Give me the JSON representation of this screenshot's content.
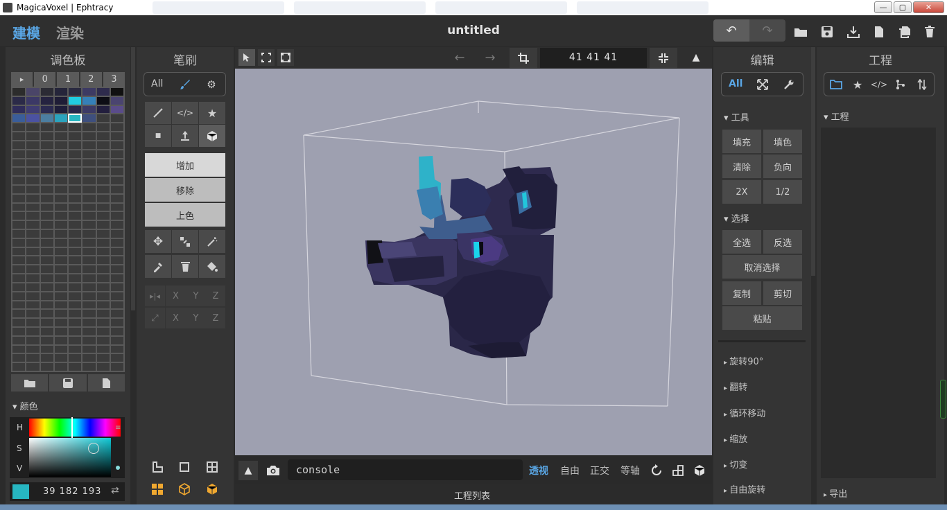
{
  "window": {
    "title": "MagicaVoxel | Ephtracy",
    "min": "—",
    "max": "▢",
    "close": "✕"
  },
  "appbar": {
    "tab_model": "建模",
    "tab_render": "渲染",
    "doc_title": "untitled"
  },
  "palette": {
    "title": "调色板",
    "tabs": [
      "▸",
      "0",
      "1",
      "2",
      "3"
    ],
    "color_section": "颜色",
    "h": "H",
    "s": "S",
    "v": "V",
    "rgb": "39 182 193",
    "selected_color": "#27b6c1"
  },
  "brush": {
    "title": "笔刷",
    "filter_all": "All",
    "mode_add": "增加",
    "mode_remove": "移除",
    "mode_paint": "上色",
    "axis_x": "X",
    "axis_y": "Y",
    "axis_z": "Z"
  },
  "viewbar": {
    "size": "41  41  41"
  },
  "bottombar": {
    "console_placeholder": "console",
    "view_persp": "透视",
    "view_free": "自由",
    "view_ortho": "正交",
    "view_iso": "等轴",
    "project_list": "工程列表"
  },
  "edit": {
    "title": "编辑",
    "filter_all": "All",
    "tools_section": "工具",
    "fill": "填充",
    "paint": "填色",
    "clear": "清除",
    "invert": "负向",
    "twox": "2X",
    "half": "1/2",
    "select_section": "选择",
    "select_all": "全选",
    "select_invert": "反选",
    "deselect": "取消选择",
    "copy": "复制",
    "cut": "剪切",
    "paste": "粘贴",
    "rotate90": "旋转90°",
    "flip": "翻转",
    "loop": "循环移动",
    "scale": "缩放",
    "cut2": "切变",
    "free_rotate": "自由旋转"
  },
  "project": {
    "title": "工程",
    "section": "工程",
    "export": "导出"
  }
}
